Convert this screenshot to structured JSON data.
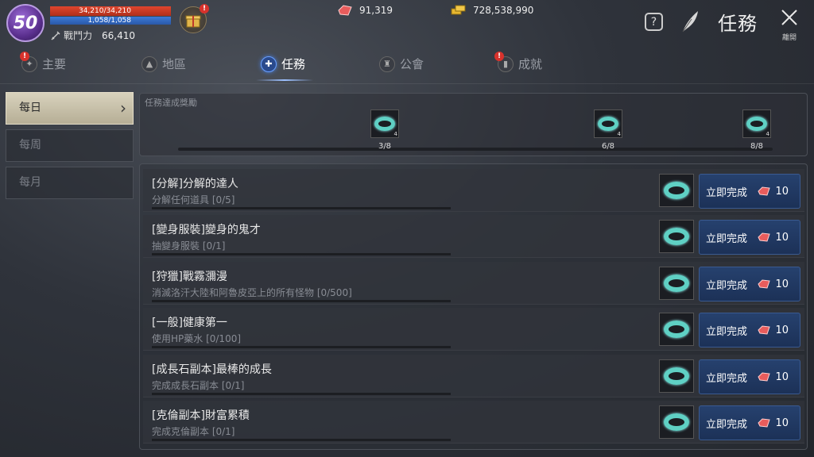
{
  "player": {
    "level": "50",
    "hp": "34,210/34,210",
    "mp": "1,058/1,058",
    "hp_fraction": 1.0,
    "mp_fraction": 1.0,
    "power_label": "戰鬥力",
    "power_value": "66,410"
  },
  "currencies": {
    "gems": "91,319",
    "gold": "728,538,990"
  },
  "header": {
    "help": "?",
    "title": "任務",
    "close_label": "離開"
  },
  "tabs": [
    {
      "label": "主要",
      "alert": true
    },
    {
      "label": "地區",
      "alert": false
    },
    {
      "label": "任務",
      "alert": false,
      "active": true
    },
    {
      "label": "公會",
      "alert": false
    },
    {
      "label": "成就",
      "alert": true
    }
  ],
  "side_menu": [
    {
      "label": "每日",
      "active": true
    },
    {
      "label": "每周",
      "active": false
    },
    {
      "label": "每月",
      "active": false
    }
  ],
  "reward_panel": {
    "title": "任務達成獎勵",
    "milestones": [
      {
        "count": "3/8",
        "qty": "4"
      },
      {
        "count": "6/8",
        "qty": "4"
      },
      {
        "count": "8/8",
        "qty": "4"
      }
    ],
    "progress_fraction": 0.0
  },
  "quests": [
    {
      "name": "[分解]分解的達人",
      "desc": "分解任何道具 [0/5]",
      "button": "立即完成",
      "cost": "10"
    },
    {
      "name": "[變身服裝]變身的鬼才",
      "desc": "抽變身服裝 [0/1]",
      "button": "立即完成",
      "cost": "10"
    },
    {
      "name": "[狩獵]戰霧瀰漫",
      "desc": "消滅洛汗大陸和阿魯皮亞上的所有怪物 [0/500]",
      "button": "立即完成",
      "cost": "10"
    },
    {
      "name": "[一般]健康第一",
      "desc": "使用HP藥水 [0/100]",
      "button": "立即完成",
      "cost": "10"
    },
    {
      "name": "[成長石副本]最棒的成長",
      "desc": "完成成長石副本 [0/1]",
      "button": "立即完成",
      "cost": "10"
    },
    {
      "name": "[克倫副本]財富累積",
      "desc": "完成克倫副本 [0/1]",
      "button": "立即完成",
      "cost": "10"
    }
  ],
  "colors": {
    "hp": "#e0452d",
    "mp": "#3c7ad8",
    "accent": "#6aa0ff",
    "alert": "#d8322c",
    "ring": "#5fd0c4"
  }
}
